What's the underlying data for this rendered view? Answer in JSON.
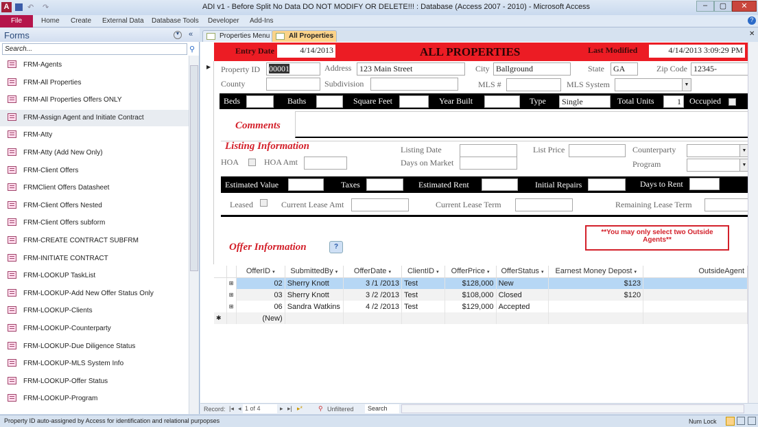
{
  "window": {
    "title": "ADI v1 - Before Split No Data DO NOT MODIFY OR DELETE!!! : Database (Access 2007 - 2010) - Microsoft Access"
  },
  "ribbon": {
    "file": "File",
    "tabs": [
      "Home",
      "Create",
      "External Data",
      "Database Tools",
      "Developer",
      "Add-Ins"
    ]
  },
  "nav": {
    "title": "Forms",
    "search_placeholder": "Search...",
    "items": [
      "FRM-Agents",
      "FRM-All Properties",
      "FRM-All Properties Offers ONLY",
      "FRM-Assign Agent and Initiate Contract",
      "FRM-Atty",
      "FRM-Atty (Add New Only)",
      "FRM-Client Offers",
      "FRMClient Offers Datasheet",
      "FRM-Client Offers Nested",
      "FRM-Client Offers subform",
      "FRM-CREATE CONTRACT SUBFRM",
      "FRM-INITIATE CONTRACT",
      "FRM-LOOKUP TaskList",
      "FRM-LOOKUP-Add New Offer Status Only",
      "FRM-LOOKUP-Clients",
      "FRM-LOOKUP-Counterparty",
      "FRM-LOOKUP-Due Diligence Status",
      "FRM-LOOKUP-MLS System Info",
      "FRM-LOOKUP-Offer Status",
      "FRM-LOOKUP-Program"
    ],
    "selected": 3
  },
  "doc_tabs": [
    "Properties Menu",
    "All Properties"
  ],
  "header": {
    "entry_date_label": "Entry Date",
    "entry_date": "4/14/2013",
    "title": "ALL PROPERTIES",
    "last_modified_label": "Last Modified",
    "last_modified": "4/14/2013 3:09:29 PM"
  },
  "property": {
    "id_label": "Property ID",
    "id": "00001",
    "address_label": "Address",
    "address": "123 Main Street",
    "city_label": "City",
    "city": "Ballground",
    "state_label": "State",
    "state": "GA",
    "zip_label": "Zip Code",
    "zip": "12345-",
    "county_label": "County",
    "subdivision_label": "Subdivision",
    "mls_label": "MLS #",
    "mls_system_label": "MLS System"
  },
  "details": {
    "beds": "Beds",
    "baths": "Baths",
    "sqft": "Square Feet",
    "year": "Year Built",
    "type_label": "Type",
    "type": "Single",
    "units_label": "Total Units",
    "units": "1",
    "occupied": "Occupied"
  },
  "comments": {
    "label": "Comments"
  },
  "listing": {
    "title": "Listing Information",
    "hoa": "HOA",
    "hoa_amt": "HOA Amt",
    "listing_date": "Listing Date",
    "dom": "Days on Market",
    "list_price": "List Price",
    "counterparty": "Counterparty",
    "program": "Program"
  },
  "values": {
    "estimated_value": "Estimated Value",
    "taxes": "Taxes",
    "estimated_rent": "Estimated Rent",
    "initial_repairs": "Initial Repairs",
    "days_to_rent": "Days to Rent"
  },
  "lease": {
    "leased": "Leased",
    "current_amt": "Current Lease Amt",
    "current_term": "Current Lease Term",
    "remaining_term": "Remaining Lease Term"
  },
  "offers": {
    "title": "Offer Information",
    "note": "**You may only select two Outside Agents**",
    "columns": [
      "OfferID",
      "SubmittedBy",
      "OfferDate",
      "ClientID",
      "OfferPrice",
      "OfferStatus",
      "Earnest Money Depost",
      "OutsideAgent"
    ],
    "rows": [
      [
        "02",
        "Sherry Knott",
        "3 /1 /2013",
        "Test",
        "$128,000",
        "New",
        "$123",
        ""
      ],
      [
        "03",
        "Sherry Knott",
        "3 /2 /2013",
        "Test",
        "$108,000",
        "Closed",
        "$120",
        ""
      ],
      [
        "06",
        "Sandra Watkins",
        "4 /2 /2013",
        "Test",
        "$129,000",
        "Accepted",
        "",
        ""
      ]
    ],
    "new_row": "(New)"
  },
  "record_nav": {
    "label": "Record:",
    "position": "1 of 4",
    "filter": "Unfiltered",
    "search": "Search"
  },
  "status": {
    "text": "Property ID auto-assigned by Access for identification and relational purpopses",
    "num_lock": "Num Lock"
  },
  "colors": {
    "header_red": "#ec1c24",
    "file_tab": "#b5154b",
    "active_tab": "#fbd38a",
    "selected_row": "#b6d7f5"
  }
}
